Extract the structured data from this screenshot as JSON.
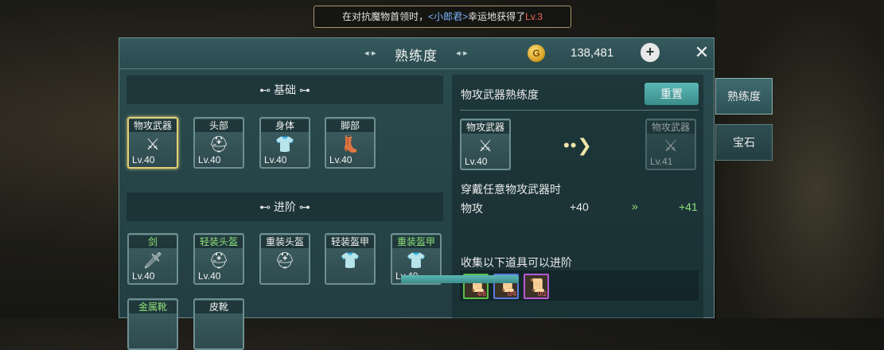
{
  "notice": {
    "prefix": "在对抗魔物首领时，",
    "name": "<小郎君>",
    "middle": "幸运地获得了",
    "suffix": "Lv.3"
  },
  "header": {
    "title": "熟练度",
    "title_deco_left": "◂·▸",
    "title_deco_right": "◂·▸",
    "coin_glyph": "G",
    "currency": "138,481",
    "plus": "+",
    "close": "✕"
  },
  "sections": {
    "basic": "⊷ 基础 ⊶",
    "advanced": "⊷ 进阶 ⊶"
  },
  "basic_items": [
    {
      "name": "物攻武器",
      "lv": "Lv.40",
      "icon": "⚔"
    },
    {
      "name": "头部",
      "lv": "Lv.40",
      "icon": "⛑"
    },
    {
      "name": "身体",
      "lv": "Lv.40",
      "icon": "👕"
    },
    {
      "name": "脚部",
      "lv": "Lv.40",
      "icon": "👢"
    }
  ],
  "advanced_items": [
    {
      "name": "剑",
      "lv": "Lv.40",
      "icon": "🗡"
    },
    {
      "name": "轻装头盔",
      "lv": "Lv.40",
      "icon": "⛑"
    },
    {
      "name": "重装头盔",
      "lv": "",
      "icon": "⛑"
    },
    {
      "name": "轻装盔甲",
      "lv": "",
      "icon": "👕"
    },
    {
      "name": "重装盔甲",
      "lv": "Lv.40",
      "icon": "👕"
    },
    {
      "name": "金属靴",
      "lv": "",
      "icon": ""
    },
    {
      "name": "皮靴",
      "lv": "",
      "icon": ""
    }
  ],
  "detail": {
    "title": "物攻武器熟练度",
    "reset": "重置",
    "current": {
      "name": "物攻武器",
      "lv": "Lv.40",
      "icon": "⚔"
    },
    "arrow": "••❯",
    "next": {
      "name": "物攻武器",
      "lv": "Lv.41",
      "icon": "⚔"
    },
    "condition": "穿戴任意物攻武器时",
    "stat_name": "物攻",
    "stat_current": "+40",
    "stat_arrow": "»",
    "stat_next": "+41",
    "collect_title": "收集以下道具可以进阶",
    "materials": [
      {
        "qty": "4/6",
        "border": "#59c04a",
        "icon": "📜"
      },
      {
        "qty": "0/4",
        "border": "#5a7be0",
        "icon": "📜"
      },
      {
        "qty": "0/2",
        "border": "#b65ad8",
        "icon": "📜"
      }
    ]
  },
  "side_tabs": [
    {
      "label": "熟练度"
    },
    {
      "label": "宝石"
    }
  ]
}
